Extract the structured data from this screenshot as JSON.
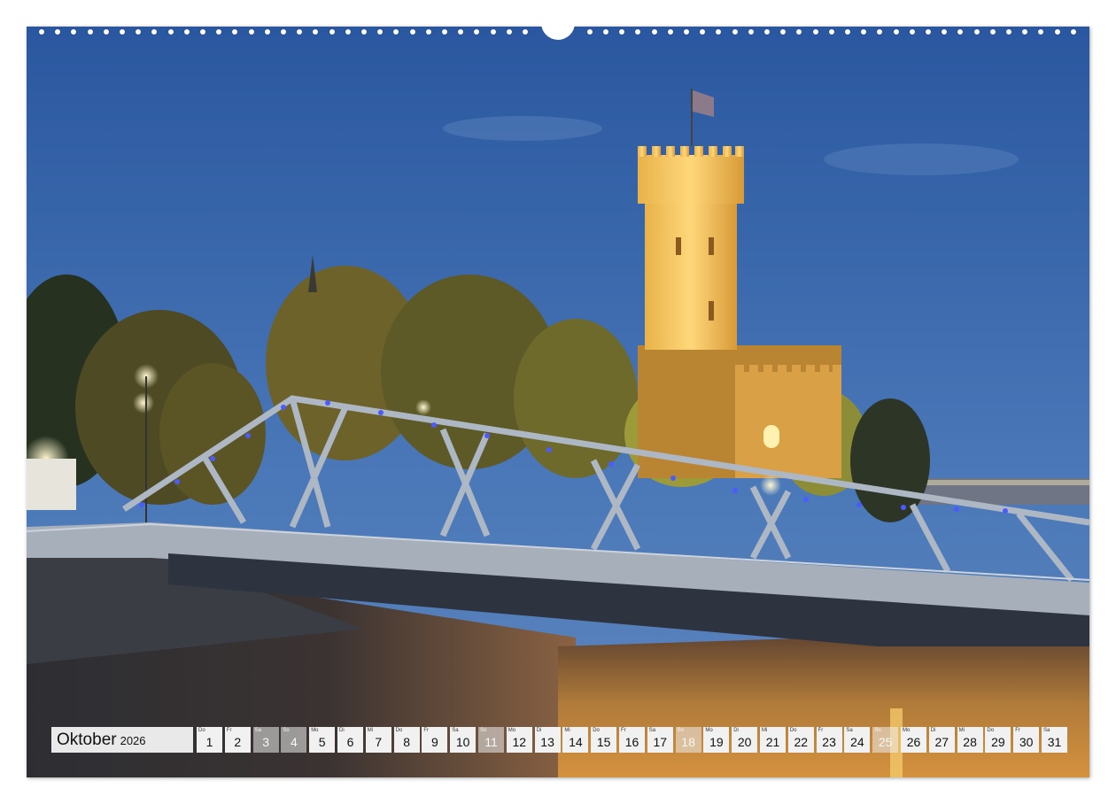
{
  "calendar": {
    "month": "Oktober",
    "year": "2026",
    "days": [
      {
        "wd": "Do",
        "d": "1",
        "weekend": false
      },
      {
        "wd": "Fr",
        "d": "2",
        "weekend": false
      },
      {
        "wd": "Sa",
        "d": "3",
        "weekend": true
      },
      {
        "wd": "So",
        "d": "4",
        "weekend": true
      },
      {
        "wd": "Mo",
        "d": "5",
        "weekend": false
      },
      {
        "wd": "Di",
        "d": "6",
        "weekend": false
      },
      {
        "wd": "Mi",
        "d": "7",
        "weekend": false
      },
      {
        "wd": "Do",
        "d": "8",
        "weekend": false
      },
      {
        "wd": "Fr",
        "d": "9",
        "weekend": false
      },
      {
        "wd": "Sa",
        "d": "10",
        "weekend": false
      },
      {
        "wd": "So",
        "d": "11",
        "weekend": true
      },
      {
        "wd": "Mo",
        "d": "12",
        "weekend": false
      },
      {
        "wd": "Di",
        "d": "13",
        "weekend": false
      },
      {
        "wd": "Mi",
        "d": "14",
        "weekend": false
      },
      {
        "wd": "Do",
        "d": "15",
        "weekend": false
      },
      {
        "wd": "Fr",
        "d": "16",
        "weekend": false
      },
      {
        "wd": "Sa",
        "d": "17",
        "weekend": false
      },
      {
        "wd": "So",
        "d": "18",
        "weekend": true
      },
      {
        "wd": "Mo",
        "d": "19",
        "weekend": false
      },
      {
        "wd": "Di",
        "d": "20",
        "weekend": false
      },
      {
        "wd": "Mi",
        "d": "21",
        "weekend": false
      },
      {
        "wd": "Do",
        "d": "22",
        "weekend": false
      },
      {
        "wd": "Fr",
        "d": "23",
        "weekend": false
      },
      {
        "wd": "Sa",
        "d": "24",
        "weekend": false
      },
      {
        "wd": "So",
        "d": "25",
        "weekend": true
      },
      {
        "wd": "Mo",
        "d": "26",
        "weekend": false
      },
      {
        "wd": "Di",
        "d": "27",
        "weekend": false
      },
      {
        "wd": "Mi",
        "d": "28",
        "weekend": false
      },
      {
        "wd": "Do",
        "d": "29",
        "weekend": false
      },
      {
        "wd": "Fr",
        "d": "30",
        "weekend": false
      },
      {
        "wd": "Sa",
        "d": "31",
        "weekend": false
      }
    ]
  },
  "colors": {
    "sky_top": "#2c5aa3",
    "sky_bottom": "#3f6fb5",
    "tower_light": "#f2c35a",
    "bridge_steel": "#9aa4b2",
    "bridge_lights": "#3a4cff",
    "water": "#c88a3a"
  },
  "icons": {
    "binding": "spiral-binding-holes",
    "hanger": "hanger-notch"
  }
}
